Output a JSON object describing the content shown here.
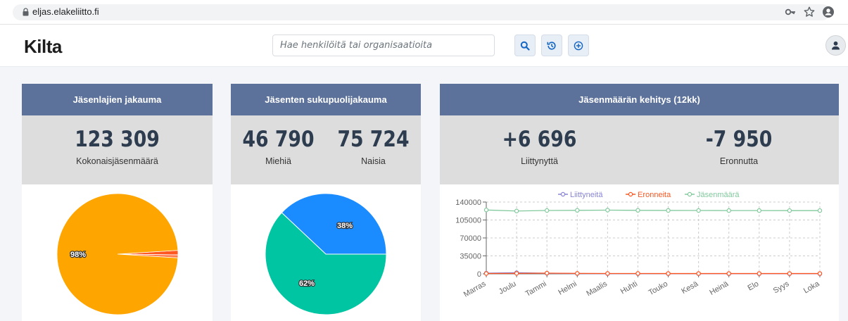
{
  "browser": {
    "url": "eljas.elakeliitto.fi",
    "icons": [
      "lock-icon",
      "key-icon",
      "star-icon",
      "account-circle-icon"
    ]
  },
  "header": {
    "logo": "Kilta",
    "search_placeholder": "Hae henkilöitä tai organisaatioita",
    "buttons": [
      "search-icon",
      "history-icon",
      "plus-circle-icon"
    ],
    "user_icon": "user-icon"
  },
  "colors": {
    "header_band": "#5d729b",
    "stats_band": "#dddddd",
    "orange": "#ffa500",
    "blue": "#1a8cff",
    "teal": "#00c5a3",
    "red": "#ff5722",
    "number": "#2d3c4e"
  },
  "cards": {
    "member_types": {
      "title": "Jäsenlajien jakauma",
      "total": "123 309",
      "total_label": "Kokonaisjäsenmäärä",
      "pie_label": "98%"
    },
    "gender": {
      "title": "Jäsenten sukupuolijakauma",
      "men": "46 790",
      "men_label": "Miehiä",
      "women": "75 724",
      "women_label": "Naisia",
      "pct_men": "38%",
      "pct_women": "62%"
    },
    "trend": {
      "title": "Jäsenmäärän kehitys (12kk)",
      "joined": "+6 696",
      "joined_label": "Liittynyttä",
      "resigned": "-7 950",
      "resigned_label": "Eronnutta"
    }
  },
  "chart_data": [
    {
      "type": "pie",
      "labels": [
        "98%"
      ],
      "values": [
        98,
        1.2,
        0.8
      ],
      "colors": [
        "#ffa500",
        "#ff5722",
        "#ff7b4d"
      ]
    },
    {
      "type": "pie",
      "labels": [
        "Miehiä",
        "Naisia"
      ],
      "values": [
        38,
        62
      ],
      "data_labels": [
        "38%",
        "62%"
      ],
      "colors": [
        "#1a8cff",
        "#00c5a3"
      ]
    },
    {
      "type": "line",
      "categories": [
        "Marras",
        "Joulu",
        "Tammi",
        "Helmi",
        "Maalis",
        "Huhti",
        "Touko",
        "Kesä",
        "Heinä",
        "Elo",
        "Syys",
        "Loka"
      ],
      "series": [
        {
          "name": "Liittyneitä",
          "color": "#8884d8",
          "values": [
            1300,
            2200,
            1100,
            600,
            400,
            300,
            300,
            300,
            250,
            250,
            250,
            250
          ]
        },
        {
          "name": "Eronneita",
          "color": "#ff5722",
          "values": [
            700,
            900,
            1400,
            900,
            700,
            700,
            600,
            600,
            600,
            600,
            600,
            600
          ]
        },
        {
          "name": "Jäsenmäärä",
          "color": "#82ca9d",
          "values": [
            124500,
            122500,
            123500,
            123800,
            124200,
            123800,
            123600,
            123500,
            123400,
            123400,
            123300,
            123300
          ]
        }
      ],
      "yticks": [
        0,
        35000,
        70000,
        105000,
        140000
      ],
      "ylim": [
        0,
        140000
      ],
      "grid": true,
      "legend": "top"
    }
  ]
}
